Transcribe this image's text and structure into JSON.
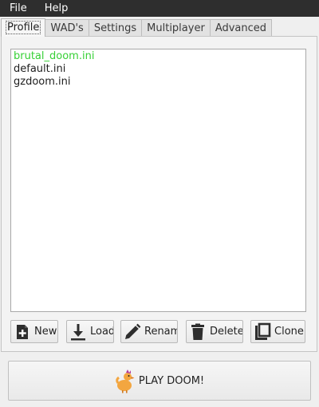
{
  "menu": [
    "File",
    "Help"
  ],
  "tabs": [
    "Profile",
    "WAD's",
    "Settings",
    "Multiplayer",
    "Advanced"
  ],
  "profiles": [
    "brutal_doom.ini",
    "default.ini",
    "gzdoom.ini"
  ],
  "selected_color": "#36d035",
  "buttons": {
    "new": "New",
    "load": "Load",
    "rename": "Rename",
    "delete": "Delete",
    "clone": "Clone"
  },
  "play_label": "PLAY DOOM!"
}
